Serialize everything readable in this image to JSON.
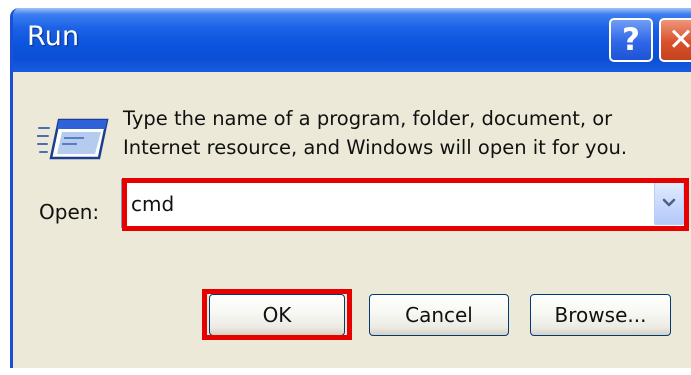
{
  "window": {
    "title": "Run",
    "help_glyph": "?",
    "close_glyph": "✕",
    "title_bar_color": "#0b4fd6",
    "face_color": "#ece9d8"
  },
  "dialog": {
    "icon": "run-program-icon",
    "description_line1": "Type the name of a program, folder, document, or",
    "description_line2": "Internet resource, and Windows will open it for you.",
    "open_label": "Open:",
    "open_value": "cmd",
    "dropdown_icon": "chevron-down-icon"
  },
  "buttons": {
    "ok": "OK",
    "cancel": "Cancel",
    "browse": "Browse..."
  },
  "annotations": {
    "highlight_color": "#e60000",
    "highlighted": [
      "open-combobox",
      "ok-button"
    ]
  }
}
